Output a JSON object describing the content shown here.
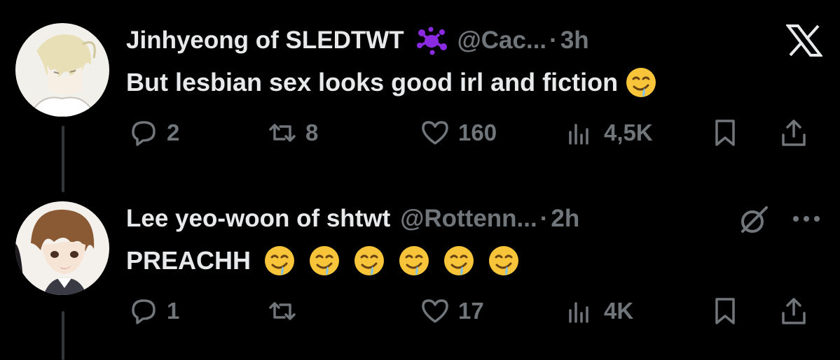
{
  "tweets": [
    {
      "name": "Jinhyeong of SLEDTWT",
      "badge_icon": "purple-splat-badge",
      "handle": "@Cac...",
      "separator": "·",
      "time": "3h",
      "text": "But lesbian sex looks good irl and fiction",
      "emoji": "drooling-face",
      "emoji_count": 1,
      "stats": {
        "replies": "2",
        "retweets": "8",
        "likes": "160",
        "views": "4,5K"
      },
      "corner_icon": "x-logo"
    },
    {
      "name": "Lee yeo-woon of shtwt",
      "handle": "@Rottenn...",
      "separator": "·",
      "time": "2h",
      "text": "PREACHH",
      "emoji": "drooling-face",
      "emoji_count": 6,
      "stats": {
        "replies": "1",
        "retweets": "",
        "likes": "17",
        "views": "4K"
      },
      "corner_icons": [
        "grok-icon",
        "more-icon"
      ]
    }
  ],
  "colors": {
    "background": "#000000",
    "primary_text": "#e7e9ea",
    "secondary_text": "#71767b",
    "badge_purple": "#8a2be2"
  }
}
